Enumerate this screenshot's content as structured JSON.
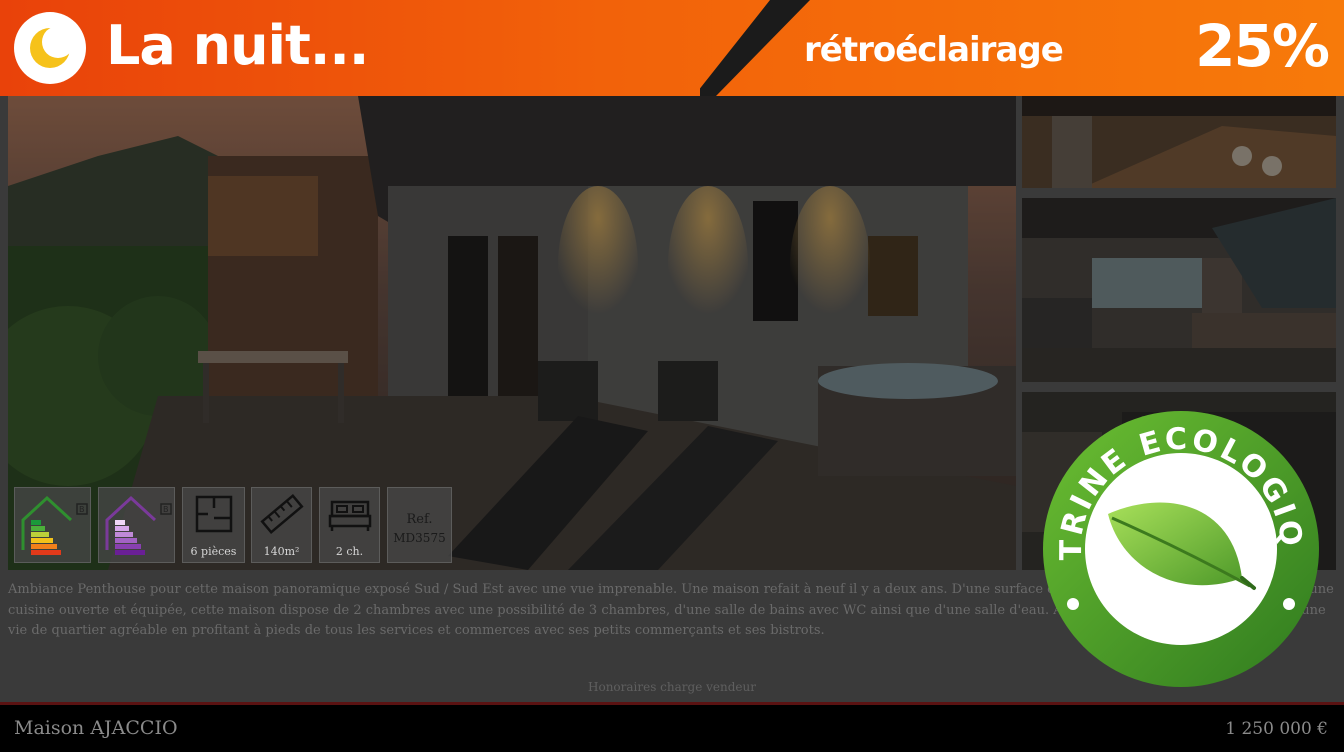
{
  "banner": {
    "title": "La nuit...",
    "mode_label": "rétroéclairage",
    "backlight_percent": "25%",
    "moon_icon": "moon-icon",
    "colors": {
      "start": "#e9420a",
      "end": "#f77a0a"
    }
  },
  "photos": {
    "main": "house-exterior-night-photo",
    "side": [
      "dining-room-photo",
      "kitchen-photo",
      "living-room-photo"
    ]
  },
  "features": {
    "energy_label": "energy-rating-icon",
    "ges_label": "ges-rating-icon",
    "rooms": "6 pièces",
    "surface": "140m²",
    "bedrooms": "2 ch.",
    "ref_title": "Ref.",
    "ref_value": "MD3575"
  },
  "listing": {
    "description": "Ambiance Penthouse pour cette maison panoramique exposé Sud / Sud Est avec une vue imprenable. Une maison refait à neuf il y a deux ans. D'une surface de 140 m² et d'un séjour de 60 m² avec une cuisine ouverte et équipée, cette maison dispose de 2 chambres avec une possibilité de 3 chambres, d'une salle de bains avec WC ainsi que d'une salle d'eau. Au pied de la maison, vous trouverez une vie de quartier agréable en profitant à pieds de tous les services et commerces avec ses petits commerçants et ses bistrots.",
    "fees": "Honoraires charge vendeur",
    "title": "Maison AJACCIO",
    "price": "1 250 000 €"
  },
  "seal": {
    "text": "VITRINE ECOLOGIQUE",
    "icon": "leaf-icon",
    "colors": {
      "ring": "#4f9a2a",
      "leaf": "#7cc43a"
    }
  }
}
